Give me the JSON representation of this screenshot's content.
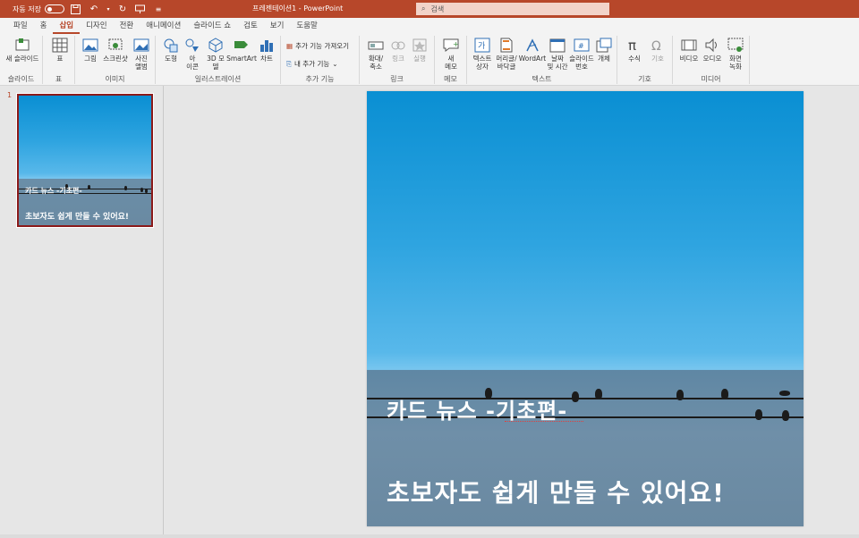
{
  "titlebar": {
    "autosave_label": "자동 저장",
    "doc_title": "프레젠테이션1  -  PowerPoint",
    "search_placeholder": "검색"
  },
  "tabs": [
    {
      "label": "파일"
    },
    {
      "label": "홈"
    },
    {
      "label": "삽입",
      "active": true
    },
    {
      "label": "디자인"
    },
    {
      "label": "전환"
    },
    {
      "label": "애니메이션"
    },
    {
      "label": "슬라이드 쇼"
    },
    {
      "label": "검토"
    },
    {
      "label": "보기"
    },
    {
      "label": "도움말"
    }
  ],
  "ribbon": {
    "groups": {
      "slides": "슬라이드",
      "table": "표",
      "images": "이미지",
      "illustrations": "일러스트레이션",
      "addins": "추가 기능",
      "links": "링크",
      "comments": "메모",
      "text": "텍스트",
      "symbols": "기호",
      "media": "미디어"
    },
    "commands": {
      "new_slide": "새 슬라이드",
      "table": "표",
      "pictures": "그림",
      "screenshot": "스크린샷",
      "photo_album_1": "사진",
      "photo_album_2": "앨범",
      "shapes": "도형",
      "icons_1": "아",
      "icons_2": "이콘",
      "model3d_1": "3D 모",
      "model3d_2": "델",
      "smartart": "SmartArt",
      "chart": "차트",
      "get_addins": "추가 기능 가져오기",
      "my_addins": "내 추가 기능",
      "zoom_1": "확대/",
      "zoom_2": "축소",
      "link": "링크",
      "action": "실행",
      "comment_1": "새",
      "comment_2": "메모",
      "textbox_1": "텍스트",
      "textbox_2": "상자",
      "header_1": "머리글/",
      "header_2": "바닥글",
      "wordart": "WordArt",
      "datetime_1": "날짜",
      "datetime_2": "및 시간",
      "slidenum_1": "슬라이드",
      "slidenum_2": "번호",
      "object": "개체",
      "equation": "수식",
      "symbol": "기호",
      "video": "비디오",
      "audio": "오디오",
      "screenrec_1": "화면",
      "screenrec_2": "녹화"
    }
  },
  "thumbnails": [
    {
      "number": "1",
      "line1": "카드 뉴스 -기초편-",
      "line2": "초보자도 쉽게 만들 수 있어요!"
    }
  ],
  "slide": {
    "title": "카드 뉴스 -기초편-",
    "subtitle": "초보자도 쉽게 만들 수 있어요!"
  },
  "colors": {
    "accent": "#b7472a",
    "thumb_border": "#8b1a1a"
  }
}
